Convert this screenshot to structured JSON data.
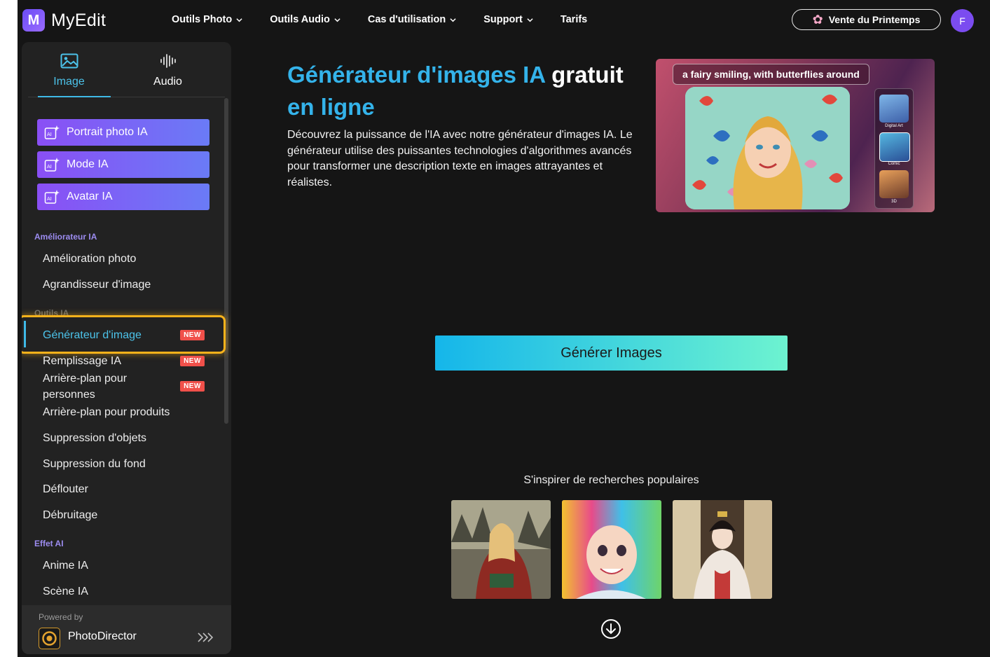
{
  "brand": {
    "name": "MyEdit",
    "accent": "#34b3ea",
    "purple": "#7b4cf0"
  },
  "topnav": {
    "menu": [
      {
        "label": "Outils Photo",
        "has_dropdown": true
      },
      {
        "label": "Outils Audio",
        "has_dropdown": true
      },
      {
        "label": "Cas d'utilisation",
        "has_dropdown": true
      },
      {
        "label": "Support",
        "has_dropdown": true
      },
      {
        "label": "Tarifs",
        "has_dropdown": false
      }
    ],
    "promo_label": "Vente du Printemps",
    "avatar_initial": "F"
  },
  "sidebar": {
    "tabs": [
      {
        "label": "Image",
        "icon": "image-icon",
        "active": true
      },
      {
        "label": "Audio",
        "icon": "audio-wave-icon",
        "active": false
      }
    ],
    "ai_buttons": [
      {
        "label": "Portrait photo IA",
        "icon": "ai-sparkle-icon"
      },
      {
        "label": "Mode IA",
        "icon": "ai-sparkle-icon"
      },
      {
        "label": "Avatar IA",
        "icon": "ai-sparkle-icon"
      }
    ],
    "sections": {
      "enhancer_title": "Améliorateur IA",
      "enhancer_items": [
        "Amélioration photo",
        "Agrandisseur d'image"
      ],
      "tools_title": "Outils IA",
      "tools_items": [
        {
          "label": "Générateur d'image",
          "badge": "NEW",
          "active": true
        },
        {
          "label": "Remplissage IA",
          "badge": "NEW"
        },
        {
          "label": "Arrière-plan pour personnes",
          "badge": "NEW"
        },
        {
          "label": "Arrière-plan pour produits"
        },
        {
          "label": "Suppression d'objets"
        },
        {
          "label": "Suppression du fond"
        },
        {
          "label": "Déflouter"
        },
        {
          "label": "Débruitage"
        }
      ],
      "effect_title": "Effet AI",
      "effect_items": [
        "Anime IA",
        "Scène IA"
      ]
    },
    "footer": {
      "powered_by": "Powered by",
      "product": "PhotoDirector"
    }
  },
  "main": {
    "title_accent": "Générateur d'images IA",
    "title_rest": "gratuit",
    "title_line2": "en ligne",
    "description": "Découvrez la puissance de l'IA avec notre générateur d'images IA. Le générateur utilise des puissantes technologies d'algorithmes avancés pour transformer une description texte en images attrayantes et réalistes.",
    "hero": {
      "prompt": "a fairy smiling, with butterflies around",
      "styles": [
        "Digital Art",
        "Comic",
        "3D"
      ]
    },
    "generate_button": "Générer Images",
    "inspire_title": "S'inspirer de recherches populaires",
    "inspire_images": [
      "elf-reading-book-image",
      "rainbow-hair-anime-girl-image",
      "geisha-kimono-image"
    ]
  }
}
